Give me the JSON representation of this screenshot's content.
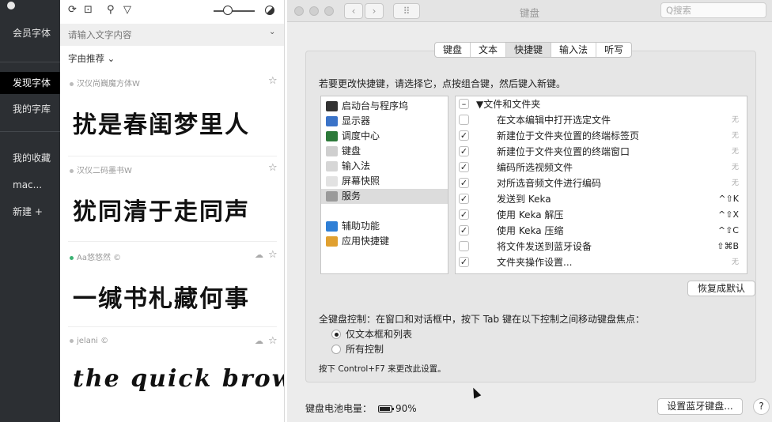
{
  "sidebar": {
    "items": [
      {
        "label": "会员字体"
      },
      {
        "label": "发现字体"
      },
      {
        "label": "我的字库"
      },
      {
        "label": "我的收藏"
      },
      {
        "label": "mac..."
      },
      {
        "label": "新建 +"
      }
    ],
    "active_index": 1
  },
  "font_panel": {
    "search_placeholder": "请输入文字内容",
    "recommend_label": "字由推荐 ⌄",
    "fonts": [
      {
        "name": "汉仪尚巍魔方体W",
        "preview": "扰是春闺梦里人",
        "status": "gray"
      },
      {
        "name": "汉仪二码墨书W",
        "preview": "犹同清于走同声",
        "status": "gray"
      },
      {
        "name": "Aa悠悠然",
        "preview": "一缄书札藏何事",
        "status": "green"
      },
      {
        "name": "jelani",
        "preview": "the quick brown",
        "status": "gray"
      }
    ]
  },
  "prefs": {
    "window_title": "键盘",
    "search_placeholder": "Q搜索",
    "tabs": [
      {
        "label": "键盘"
      },
      {
        "label": "文本"
      },
      {
        "label": "快捷键"
      },
      {
        "label": "输入法"
      },
      {
        "label": "听写"
      }
    ],
    "selected_tab": 2,
    "instruction": "若要更改快捷键，请选择它，点按组合键，然后键入新键。",
    "categories": [
      {
        "label": "启动台与程序坞",
        "icon": "launchpad-icon",
        "color": "#333333"
      },
      {
        "label": "显示器",
        "icon": "display-icon",
        "color": "#3a73c8"
      },
      {
        "label": "调度中心",
        "icon": "mission-control-icon",
        "color": "#2d7a3a"
      },
      {
        "label": "键盘",
        "icon": "keyboard-icon",
        "color": "#cfcfcf"
      },
      {
        "label": "输入法",
        "icon": "input-source-icon",
        "color": "#d6d6d6"
      },
      {
        "label": "屏幕快照",
        "icon": "screenshot-icon",
        "color": "#e2e2e2"
      },
      {
        "label": "服务",
        "icon": "services-gear-icon",
        "color": "#9a9a9a"
      },
      {
        "label": "",
        "icon": "",
        "color": "#ffffff"
      },
      {
        "label": "辅助功能",
        "icon": "accessibility-icon",
        "color": "#2f7fd6"
      },
      {
        "label": "应用快捷键",
        "icon": "app-shortcuts-icon",
        "color": "#e0a030"
      }
    ],
    "selected_category": 6,
    "shortcuts": [
      {
        "label": "▼文件和文件夹",
        "checked": "–",
        "key": "",
        "header": true
      },
      {
        "label": "在文本编辑中打开选定文件",
        "checked": "",
        "key": "无"
      },
      {
        "label": "新建位于文件夹位置的终端标签页",
        "checked": "✓",
        "key": "无"
      },
      {
        "label": "新建位于文件夹位置的终端窗口",
        "checked": "✓",
        "key": "无"
      },
      {
        "label": "编码所选视频文件",
        "checked": "✓",
        "key": "无"
      },
      {
        "label": "对所选音频文件进行编码",
        "checked": "✓",
        "key": "无"
      },
      {
        "label": "发送到 Keka",
        "checked": "✓",
        "key": "^⇧K"
      },
      {
        "label": "使用 Keka 解压",
        "checked": "✓",
        "key": "^⇧X"
      },
      {
        "label": "使用 Keka 压缩",
        "checked": "✓",
        "key": "^⇧C"
      },
      {
        "label": "将文件发送到蓝牙设备",
        "checked": "",
        "key": "⇧⌘B"
      },
      {
        "label": "文件夹操作设置...",
        "checked": "✓",
        "key": "无"
      }
    ],
    "restore_button": "恢复成默认",
    "keyboard_control": "全键盘控制：在窗口和对话框中，按下 Tab 键在以下控制之间移动键盘焦点：",
    "radio_options": [
      {
        "label": "仅文本框和列表",
        "selected": true
      },
      {
        "label": "所有控制",
        "selected": false
      }
    ],
    "hint": "按下 Control+F7 来更改此设置。",
    "battery_label": "键盘电池电量：",
    "battery_value": "90%",
    "bluetooth_button": "设置蓝牙键盘...",
    "help_button": "?"
  }
}
